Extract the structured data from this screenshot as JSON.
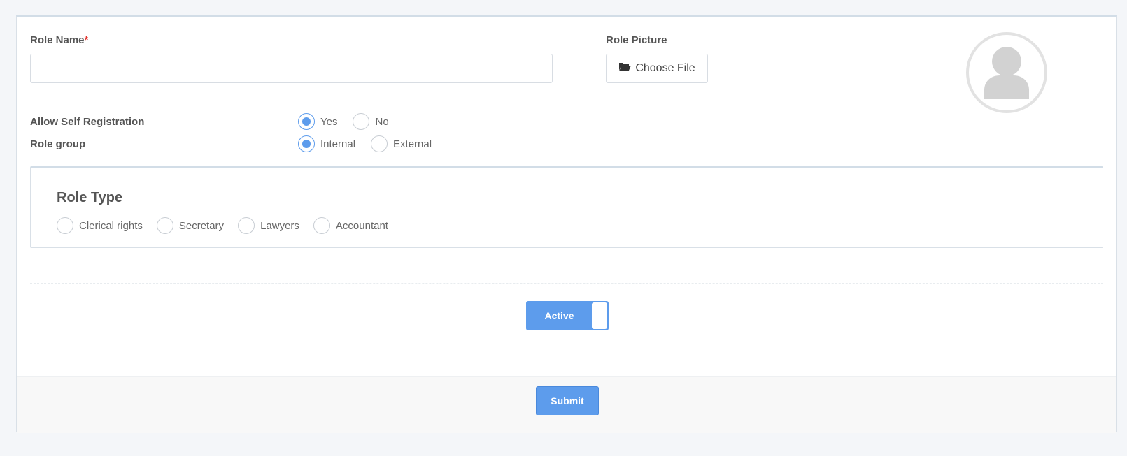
{
  "form": {
    "role_name": {
      "label": "Role Name",
      "required_mark": "*",
      "value": "",
      "placeholder": ""
    },
    "role_picture": {
      "label": "Role Picture",
      "button_label": "Choose File",
      "icon": "folder-open-icon"
    },
    "avatar": {
      "icon": "user-placeholder-icon"
    },
    "self_registration": {
      "label": "Allow Self Registration",
      "options": [
        {
          "label": "Yes",
          "checked": true
        },
        {
          "label": "No",
          "checked": false
        }
      ]
    },
    "role_group": {
      "label": "Role group",
      "options": [
        {
          "label": "Internal",
          "checked": true
        },
        {
          "label": "External",
          "checked": false
        }
      ]
    },
    "role_type": {
      "title": "Role Type",
      "options": [
        {
          "label": "Clerical rights",
          "checked": false
        },
        {
          "label": "Secretary",
          "checked": false
        },
        {
          "label": "Lawyers",
          "checked": false
        },
        {
          "label": "Accountant",
          "checked": false
        }
      ]
    },
    "status_toggle": {
      "label": "Active",
      "on": true
    },
    "submit_label": "Submit"
  },
  "colors": {
    "accent": "#5d9cec",
    "required": "#e3342f",
    "background": "#f4f6f9"
  }
}
